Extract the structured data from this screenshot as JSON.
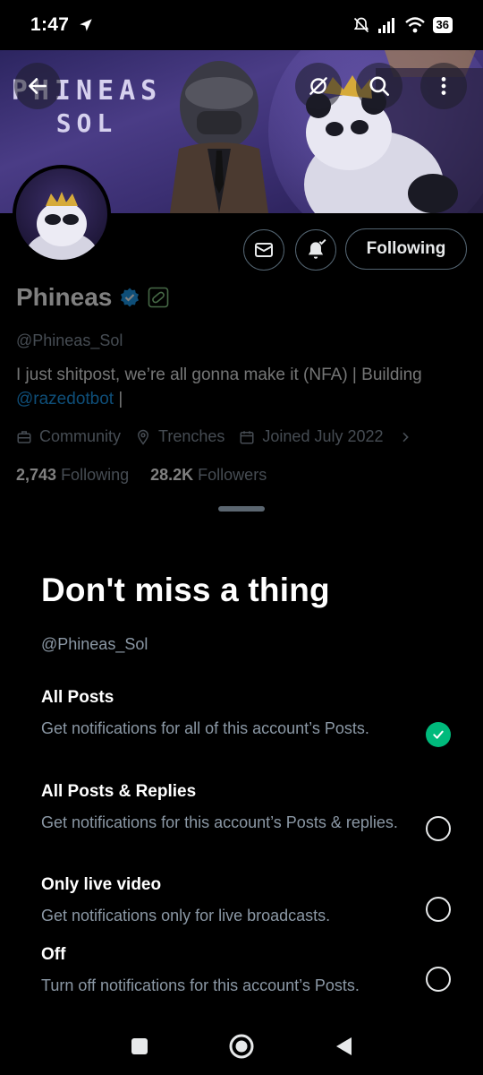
{
  "status_bar": {
    "time": "1:47",
    "battery": "36"
  },
  "banner": {
    "logo_line1": "PHINEAS",
    "logo_line2": "SOL"
  },
  "profile": {
    "name": "Phineas",
    "handle": "@Phineas_Sol",
    "bio_text": "I just shitpost, we’re all gonna make it (NFA) | Building",
    "bio_link": "@razedotbot",
    "bio_suffix": " |",
    "community": "Community",
    "location": "Trenches",
    "joined": "Joined July 2022",
    "following_count": "2,743",
    "following_label": "Following",
    "followers_count": "28.2K",
    "followers_label": "Followers",
    "following_button": "Following"
  },
  "sheet": {
    "title": "Don't miss a thing",
    "handle": "@Phineas_Sol",
    "options": [
      {
        "title": "All Posts",
        "desc": "Get notifications for all of this account’s Posts.",
        "selected": true
      },
      {
        "title": "All Posts & Replies",
        "desc": "Get notifications for this account’s Posts & replies.",
        "selected": false
      },
      {
        "title": "Only live video",
        "desc": "Get notifications only for live broadcasts.",
        "selected": false
      },
      {
        "title": "Off",
        "desc": "Turn off notifications for this account’s Posts.",
        "selected": false
      }
    ]
  },
  "colors": {
    "accent": "#1d9bf0",
    "selected": "#00ba7c",
    "background": "#000000"
  }
}
